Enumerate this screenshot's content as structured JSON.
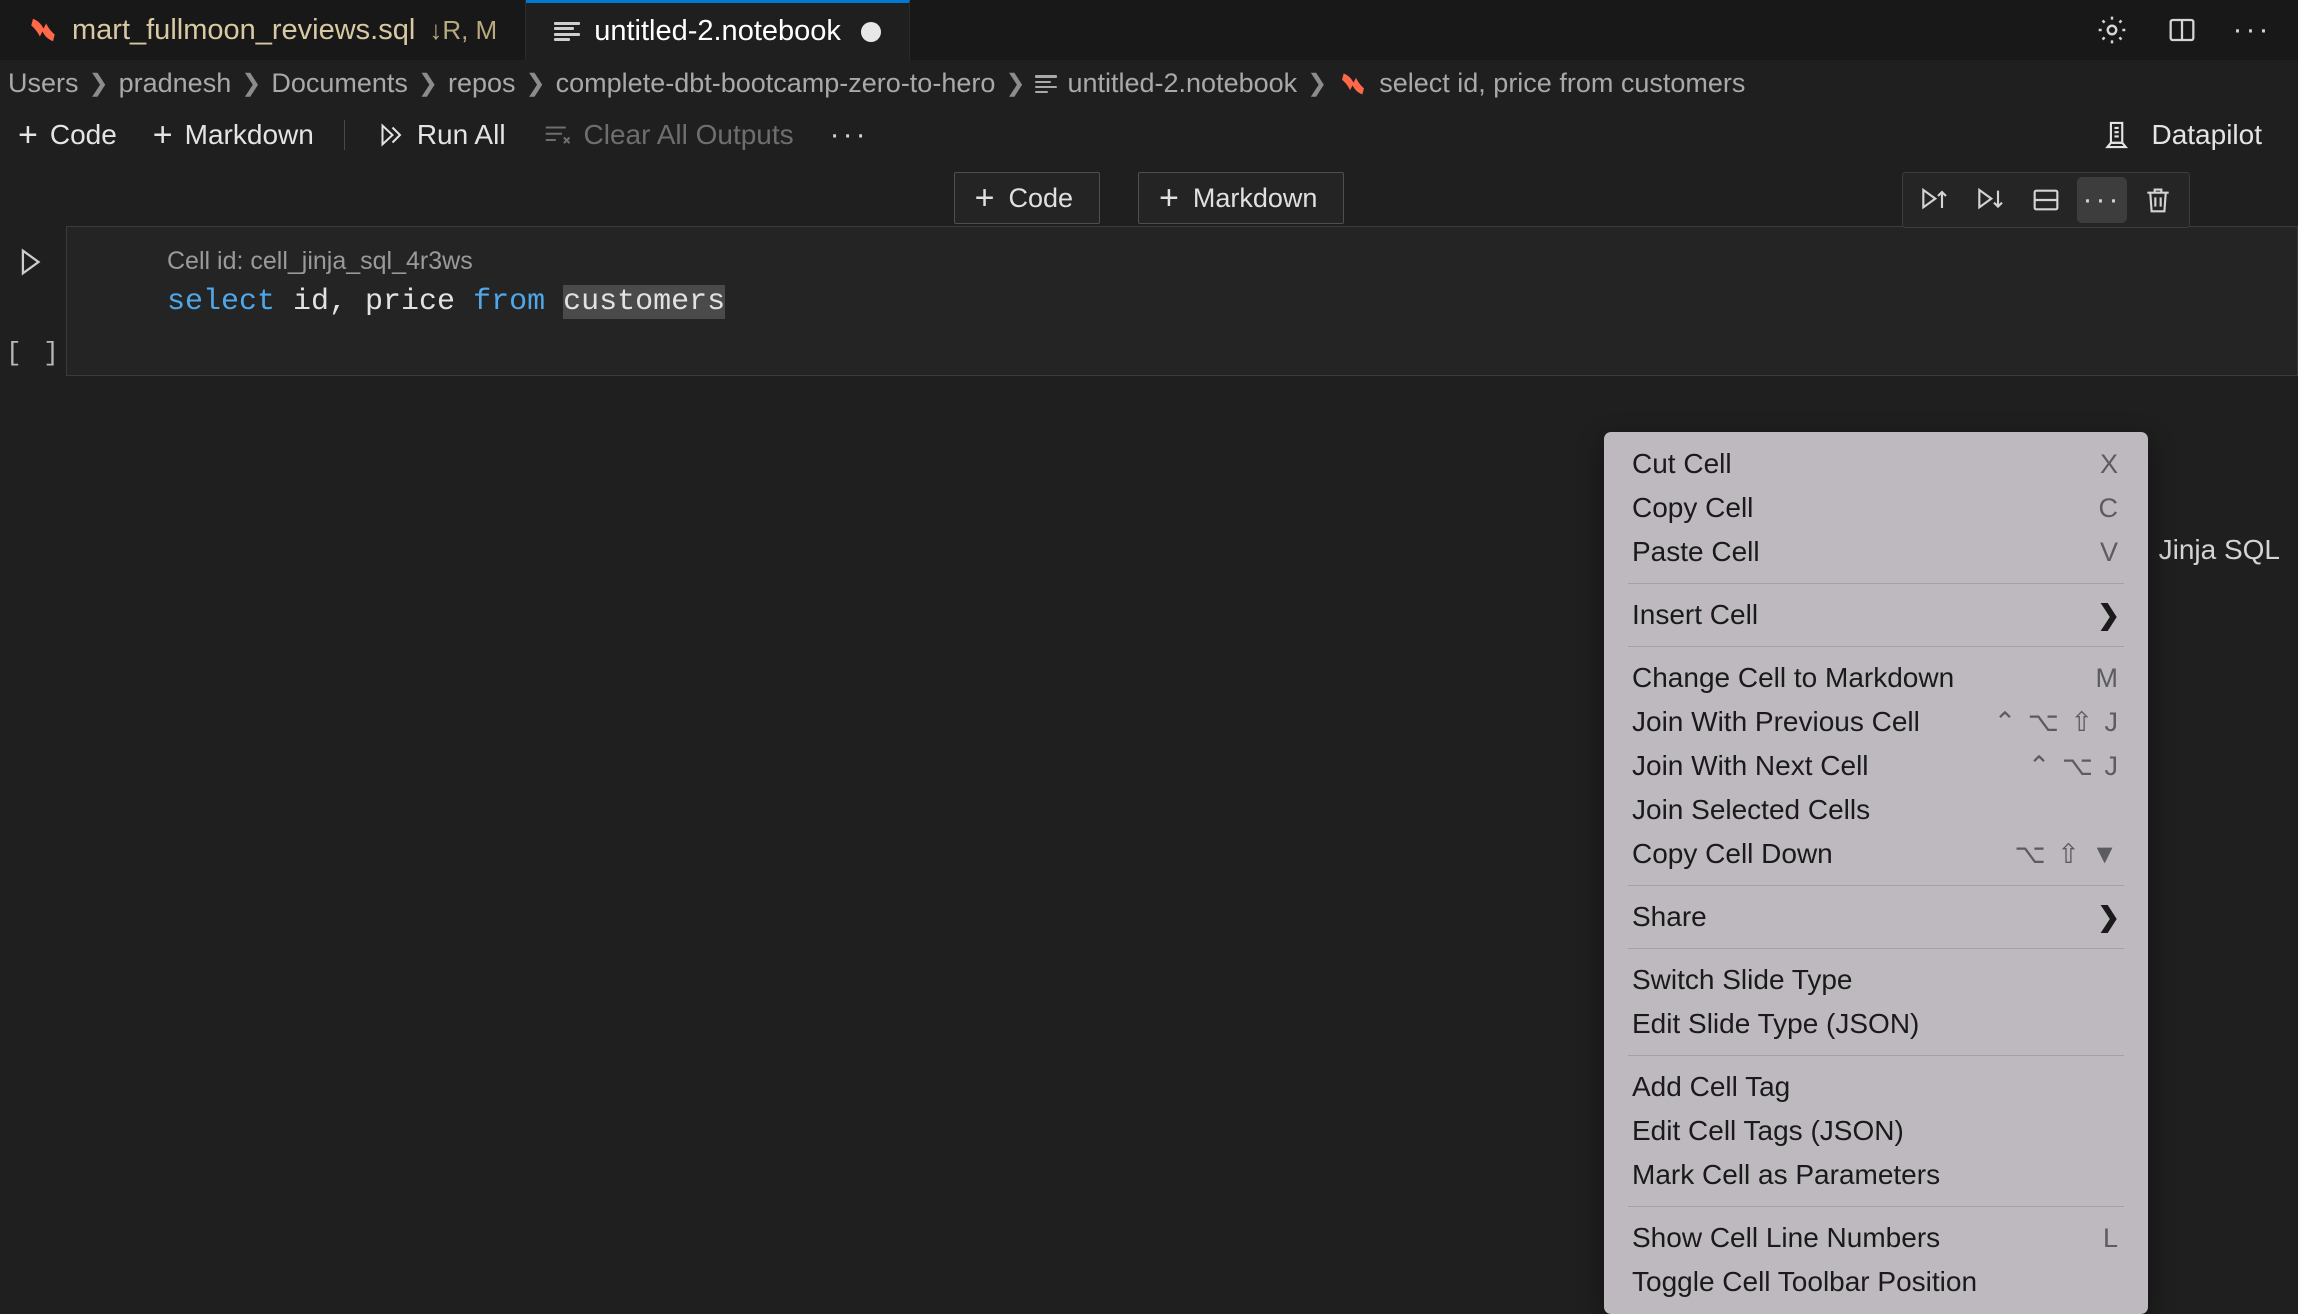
{
  "window": {
    "background_color": "#1f1f1f",
    "accent_color": "#0078d4",
    "dbt_logo_color": "#ff694a"
  },
  "tabs": [
    {
      "name": "mart_fullmoon_reviews.sql",
      "suffix": "↓R, M",
      "icon": "dbt-logo-icon",
      "active": false,
      "dirty": false
    },
    {
      "name": "untitled-2.notebook",
      "suffix": "",
      "icon": "notebook-icon",
      "active": true,
      "dirty": true
    }
  ],
  "tabbar_actions": [
    {
      "label": "",
      "icon": "gear-icon"
    },
    {
      "label": "",
      "icon": "split-editor-icon"
    },
    {
      "label": "",
      "icon": "more-actions-icon"
    }
  ],
  "breadcrumbs": [
    {
      "label": "Users",
      "icon": ""
    },
    {
      "label": "pradnesh",
      "icon": ""
    },
    {
      "label": "Documents",
      "icon": ""
    },
    {
      "label": "repos",
      "icon": ""
    },
    {
      "label": "complete-dbt-bootcamp-zero-to-hero",
      "icon": ""
    },
    {
      "label": "untitled-2.notebook",
      "icon": "notebook-icon"
    },
    {
      "label": "select id, price from customers",
      "icon": "dbt-logo-icon"
    }
  ],
  "notebook_toolbar": {
    "code_label": "Code",
    "markdown_label": "Markdown",
    "run_all_label": "Run All",
    "clear_all_outputs_label": "Clear All Outputs",
    "clear_all_outputs_disabled": true,
    "more_label": "···",
    "datapilot_label": "Datapilot"
  },
  "cell_insert_buttons": {
    "code_label": "Code",
    "markdown_label": "Markdown"
  },
  "cell_toolbar": [
    {
      "icon": "run-above-icon",
      "active": false
    },
    {
      "icon": "run-below-icon",
      "active": false
    },
    {
      "icon": "split-cell-icon",
      "active": false
    },
    {
      "icon": "more-cell-actions-icon",
      "active": true
    },
    {
      "icon": "delete-cell-icon",
      "active": false
    }
  ],
  "cell": {
    "cell_id_label": "Cell id: cell_jinja_sql_4r3ws",
    "code_tokens": [
      {
        "text": "select",
        "type": "keyword"
      },
      {
        "text": " id, price ",
        "type": "plain"
      },
      {
        "text": "from",
        "type": "keyword"
      },
      {
        "text": " ",
        "type": "plain"
      },
      {
        "text": "customers",
        "type": "selected"
      }
    ],
    "execution_count": "[ ]",
    "language_label": "Jinja SQL"
  },
  "context_menu": {
    "background_color": "#bdb9bf",
    "groups": [
      {
        "items": [
          {
            "label": "Cut Cell",
            "accel": "X",
            "submenu": false
          },
          {
            "label": "Copy Cell",
            "accel": "C",
            "submenu": false
          },
          {
            "label": "Paste Cell",
            "accel": "V",
            "submenu": false
          }
        ]
      },
      {
        "items": [
          {
            "label": "Insert Cell",
            "accel": "",
            "submenu": true
          }
        ]
      },
      {
        "items": [
          {
            "label": "Change Cell to Markdown",
            "accel": "M",
            "submenu": false
          },
          {
            "label": "Join With Previous Cell",
            "accel": "⌃ ⌥ ⇧ J",
            "submenu": false
          },
          {
            "label": "Join With Next Cell",
            "accel": "⌃ ⌥ J",
            "submenu": false
          },
          {
            "label": "Join Selected Cells",
            "accel": "",
            "submenu": false
          },
          {
            "label": "Copy Cell Down",
            "accel": "⌥ ⇧ ▼",
            "submenu": false
          }
        ]
      },
      {
        "items": [
          {
            "label": "Share",
            "accel": "",
            "submenu": true
          }
        ]
      },
      {
        "items": [
          {
            "label": "Switch Slide Type",
            "accel": "",
            "submenu": false
          },
          {
            "label": "Edit Slide Type (JSON)",
            "accel": "",
            "submenu": false
          }
        ]
      },
      {
        "items": [
          {
            "label": "Add Cell Tag",
            "accel": "",
            "submenu": false
          },
          {
            "label": "Edit Cell Tags (JSON)",
            "accel": "",
            "submenu": false
          },
          {
            "label": "Mark Cell as Parameters",
            "accel": "",
            "submenu": false
          }
        ]
      },
      {
        "items": [
          {
            "label": "Show Cell Line Numbers",
            "accel": "L",
            "submenu": false
          },
          {
            "label": "Toggle Cell Toolbar Position",
            "accel": "",
            "submenu": false
          }
        ]
      }
    ]
  }
}
